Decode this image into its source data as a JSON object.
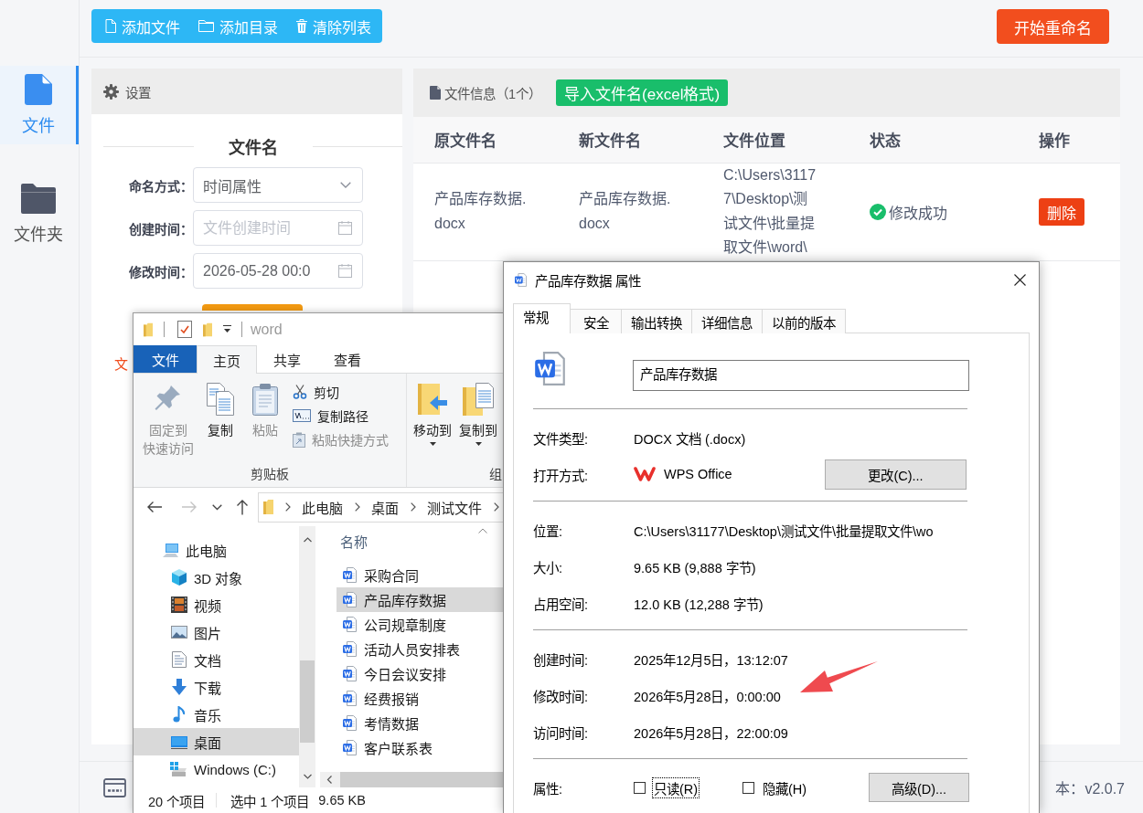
{
  "sidebar": {
    "items": [
      {
        "label": "文件",
        "selected": true
      },
      {
        "label": "文件夹",
        "selected": false
      }
    ]
  },
  "toolbar": {
    "buttons": [
      {
        "label": "添加文件"
      },
      {
        "label": "添加目录"
      },
      {
        "label": "清除列表"
      }
    ],
    "start_button": "开始重命名"
  },
  "settings": {
    "title": "设置",
    "section": "文件名",
    "fields": [
      {
        "label": "命名方式：",
        "kind": "select",
        "value": "时间属性"
      },
      {
        "label": "创建时间：",
        "kind": "date",
        "placeholder": "文件创建时间"
      },
      {
        "label": "修改时间：",
        "kind": "date",
        "value": "2026-05-28 00:0"
      }
    ],
    "note": "文"
  },
  "file_panel": {
    "title": "文件信息（1个）",
    "import_button": "导入文件名(excel格式)",
    "table": {
      "columns": [
        "原文件名",
        "新文件名",
        "文件位置",
        "状态",
        "操作"
      ],
      "rows": [
        {
          "original_name": "产品库存数据.docx",
          "new_name": "产品库存数据.docx",
          "location": "C:\\Users\\31177\\Desktop\\测试文件\\批量提取文件\\word\\",
          "status": "修改成功",
          "action": "删除"
        }
      ]
    }
  },
  "explorer": {
    "title": "word",
    "ribbon_tabs": [
      {
        "label": "文件",
        "kind": "menu",
        "selected": false
      },
      {
        "label": "主页",
        "kind": "tab",
        "selected": true
      },
      {
        "label": "共享",
        "kind": "tab",
        "selected": false
      },
      {
        "label": "查看",
        "kind": "tab",
        "selected": false
      }
    ],
    "ribbon_groups": [
      {
        "label": "剪贴板",
        "large": [
          {
            "lines": [
              "固定到",
              "快速访问"
            ],
            "disabled": true,
            "dropdown": false
          },
          {
            "lines": [
              "复制"
            ],
            "disabled": false,
            "dropdown": false
          },
          {
            "lines": [
              "粘贴"
            ],
            "disabled": true,
            "dropdown": false
          }
        ],
        "small": [
          {
            "label": "剪切",
            "disabled": false
          },
          {
            "label": "复制路径",
            "disabled": false
          },
          {
            "label": "粘贴快捷方式",
            "disabled": true
          }
        ]
      },
      {
        "label": "组",
        "large": [
          {
            "lines": [
              "移动到"
            ],
            "disabled": false,
            "dropdown": true
          },
          {
            "lines": [
              "复制到"
            ],
            "disabled": false,
            "dropdown": true
          }
        ]
      }
    ],
    "nav_buttons": [
      {
        "disabled": false
      },
      {
        "disabled": true
      },
      {
        "disabled": false
      },
      {
        "disabled": false
      }
    ],
    "breadcrumb": [
      "此电脑",
      "桌面",
      "测试文件"
    ],
    "nav_tree": [
      {
        "label": "此电脑",
        "selected": false,
        "children": [
          {
            "label": "3D 对象",
            "selected": false
          },
          {
            "label": "视频",
            "selected": false
          },
          {
            "label": "图片",
            "selected": false
          },
          {
            "label": "文档",
            "selected": false
          },
          {
            "label": "下载",
            "selected": false
          },
          {
            "label": "音乐",
            "selected": false
          },
          {
            "label": "桌面",
            "selected": true
          },
          {
            "label": "Windows (C:)",
            "selected": false
          }
        ]
      }
    ],
    "file_list": {
      "column": "名称",
      "items": [
        {
          "label": "采购合同",
          "selected": false
        },
        {
          "label": "产品库存数据",
          "selected": true
        },
        {
          "label": "公司规章制度",
          "selected": false
        },
        {
          "label": "活动人员安排表",
          "selected": false
        },
        {
          "label": "今日会议安排",
          "selected": false
        },
        {
          "label": "经费报销",
          "selected": false
        },
        {
          "label": "考情数据",
          "selected": false
        },
        {
          "label": "客户联系表",
          "selected": false
        }
      ]
    },
    "status": [
      "20 个项目",
      "选中 1 个项目",
      "9.65 KB"
    ]
  },
  "properties": {
    "title": "产品库存数据 属性",
    "tabs": [
      {
        "label": "常规",
        "selected": true
      },
      {
        "label": "安全",
        "selected": false
      },
      {
        "label": "输出转换",
        "selected": false
      },
      {
        "label": "详细信息",
        "selected": false
      },
      {
        "label": "以前的版本",
        "selected": false
      }
    ],
    "name": "产品库存数据",
    "sections": [
      {
        "rows": [
          {
            "kind": "text",
            "label": "文件类型:",
            "value": "DOCX 文档 (.docx)"
          },
          {
            "kind": "app",
            "label": "打开方式:",
            "value": "WPS Office",
            "button": "更改(C)..."
          }
        ]
      },
      {
        "rows": [
          {
            "kind": "text",
            "label": "位置:",
            "value": "C:\\Users\\31177\\Desktop\\测试文件\\批量提取文件\\wo"
          },
          {
            "kind": "text",
            "label": "大小:",
            "value": "9.65 KB (9,888 字节)"
          },
          {
            "kind": "text",
            "label": "占用空间:",
            "value": "12.0 KB (12,288 字节)"
          }
        ]
      },
      {
        "rows": [
          {
            "kind": "text",
            "label": "创建时间:",
            "value": "2025年12月5日，13:12:07"
          },
          {
            "kind": "text",
            "label": "修改时间:",
            "value": "2026年5月28日，0:00:00"
          },
          {
            "kind": "text",
            "label": "访问时间:",
            "value": "2026年5月28日，22:00:09"
          }
        ]
      }
    ],
    "attributes": {
      "label": "属性:",
      "checkboxes": [
        {
          "label": "只读(R)",
          "checked": false,
          "focused": true
        },
        {
          "label": "隐藏(H)",
          "checked": false,
          "focused": false
        }
      ],
      "button": "高级(D)..."
    }
  },
  "status_bar": {
    "version": "本：v2.0.7"
  }
}
